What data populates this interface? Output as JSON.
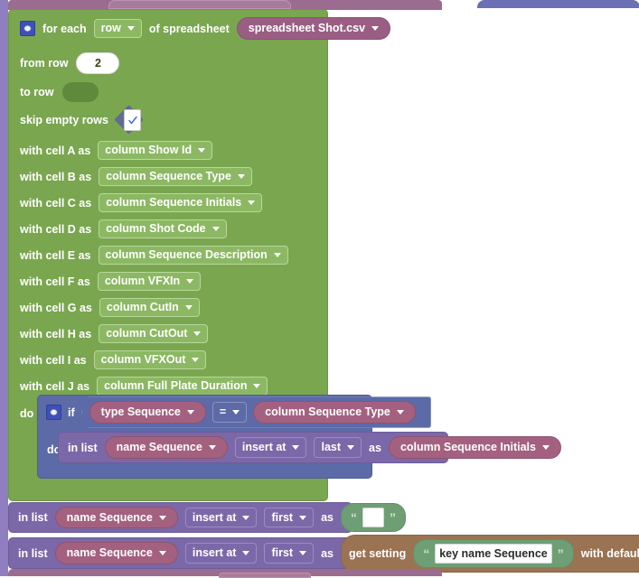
{
  "workspace": {
    "top_partial_block": {
      "present": true
    },
    "bottom_partial_block": {
      "present": true
    }
  },
  "colors": {
    "green_block": "#7aa650",
    "green_field": "#8cb863",
    "pink_value": "#9a5e84",
    "purple_statement": "#7b68a8",
    "indigo_if": "#5d6aa8",
    "brown_setting": "#9a7352",
    "text_string": "#6e9e74",
    "parent_strip": "#8f7fc0",
    "mutator_gear": "#3f51b5"
  },
  "for_each": {
    "mutator_icon": "gear-icon",
    "label_for_each": "for each",
    "loop_var": "row",
    "label_of_spreadsheet": "of spreadsheet",
    "spreadsheet": "spreadsheet Shot.csv",
    "from_row_label": "from row",
    "from_row_value": "2",
    "to_row_label": "to row",
    "to_row_value": "",
    "skip_empty_label": "skip empty rows",
    "skip_empty_checked": true,
    "cells": [
      {
        "label": "with cell A as",
        "value": "column Show Id"
      },
      {
        "label": "with cell B as",
        "value": "column Sequence Type"
      },
      {
        "label": "with cell C as",
        "value": "column Sequence Initials"
      },
      {
        "label": "with cell D as",
        "value": "column Shot Code"
      },
      {
        "label": "with cell E as",
        "value": "column Sequence Description"
      },
      {
        "label": "with cell F as",
        "value": "column VFXIn"
      },
      {
        "label": "with cell G as",
        "value": "column CutIn"
      },
      {
        "label": "with cell H as",
        "value": "column CutOut"
      },
      {
        "label": "with cell I as",
        "value": "column VFXOut"
      },
      {
        "label": "with cell J as",
        "value": "column Full Plate Duration"
      }
    ],
    "do_label": "do"
  },
  "if_block": {
    "mutator_icon": "gear-icon",
    "if_label": "if",
    "left_operand": "type Sequence",
    "operator": "=",
    "right_operand": "column Sequence Type",
    "do_label": "do",
    "body": {
      "in_list_label": "in list",
      "list_name": "name Sequence",
      "action": "insert at",
      "position": "last",
      "as_label": "as",
      "value": "column Sequence Initials"
    }
  },
  "in_list_rows": [
    {
      "in_list_label": "in list",
      "list_name": "name Sequence",
      "action": "insert at",
      "position": "first",
      "as_label": "as",
      "value_type": "text",
      "text_value": ""
    },
    {
      "in_list_label": "in list",
      "list_name": "name Sequence",
      "action": "insert at",
      "position": "first",
      "as_label": "as",
      "value_type": "get-setting",
      "get_setting_label": "get setting",
      "key_value": "key name Sequence",
      "default_label": "with default value",
      "default_value": ""
    }
  ]
}
